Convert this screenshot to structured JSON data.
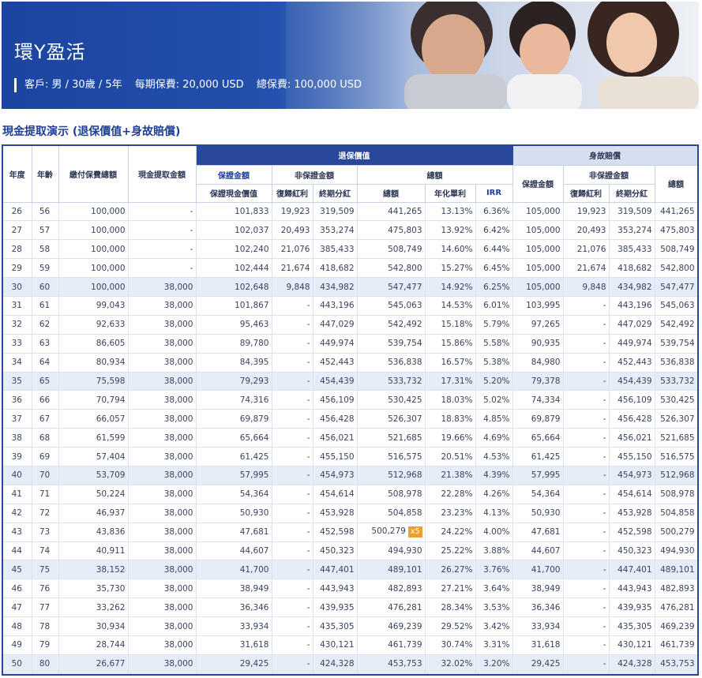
{
  "banner": {
    "title": "環Y盈活",
    "client": "客戶: 男 / 30歲 / 5年",
    "premium": "每期保費: 20,000 USD",
    "total_premium": "總保費: 100,000 USD"
  },
  "section_title": "現金提取演示 (退保價值+身故賠償)",
  "headers": {
    "year": "年度",
    "age": "年齡",
    "premium_paid": "繳付保費總額",
    "withdrawal": "現金提取金額",
    "surrender_group": "退保價值",
    "death_group": "身故賠償",
    "guaranteed": "保證金額",
    "non_guaranteed": "非保證金額",
    "total": "總額",
    "guaranteed_cash_value": "保證現金價值",
    "reversionary_bonus": "復歸紅利",
    "terminal_dividend": "終期分紅",
    "total_amount": "總額",
    "annual_simple": "年化單利",
    "irr": "IRR",
    "death_guaranteed": "保證金額",
    "death_non_guaranteed": "非保證金額",
    "death_total": "總額",
    "death_reversionary": "復歸紅利",
    "death_terminal": "終期分紅"
  },
  "rows": [
    {
      "y": "26",
      "a": "56",
      "p": "100,000",
      "w": "-",
      "g": "101,833",
      "rb": "19,923",
      "td": "319,509",
      "t": "441,265",
      "s": "13.13%",
      "irr": "6.36%",
      "dg": "105,000",
      "drb": "19,923",
      "dtd": "319,509",
      "dt": "441,265"
    },
    {
      "y": "27",
      "a": "57",
      "p": "100,000",
      "w": "-",
      "g": "102,037",
      "rb": "20,493",
      "td": "353,274",
      "t": "475,803",
      "s": "13.92%",
      "irr": "6.42%",
      "dg": "105,000",
      "drb": "20,493",
      "dtd": "353,274",
      "dt": "475,803"
    },
    {
      "y": "28",
      "a": "58",
      "p": "100,000",
      "w": "-",
      "g": "102,240",
      "rb": "21,076",
      "td": "385,433",
      "t": "508,749",
      "s": "14.60%",
      "irr": "6.44%",
      "dg": "105,000",
      "drb": "21,076",
      "dtd": "385,433",
      "dt": "508,749"
    },
    {
      "y": "29",
      "a": "59",
      "p": "100,000",
      "w": "-",
      "g": "102,444",
      "rb": "21,674",
      "td": "418,682",
      "t": "542,800",
      "s": "15.27%",
      "irr": "6.45%",
      "dg": "105,000",
      "drb": "21,674",
      "dtd": "418,682",
      "dt": "542,800"
    },
    {
      "y": "30",
      "a": "60",
      "p": "100,000",
      "w": "38,000",
      "g": "102,648",
      "rb": "9,848",
      "td": "434,982",
      "t": "547,477",
      "s": "14.92%",
      "irr": "6.25%",
      "dg": "105,000",
      "drb": "9,848",
      "dtd": "434,982",
      "dt": "547,477"
    },
    {
      "y": "31",
      "a": "61",
      "p": "99,043",
      "w": "38,000",
      "g": "101,867",
      "rb": "-",
      "td": "443,196",
      "t": "545,063",
      "s": "14.53%",
      "irr": "6.01%",
      "dg": "103,995",
      "drb": "-",
      "dtd": "443,196",
      "dt": "545,063"
    },
    {
      "y": "32",
      "a": "62",
      "p": "92,633",
      "w": "38,000",
      "g": "95,463",
      "rb": "-",
      "td": "447,029",
      "t": "542,492",
      "s": "15.18%",
      "irr": "5.79%",
      "dg": "97,265",
      "drb": "-",
      "dtd": "447,029",
      "dt": "542,492"
    },
    {
      "y": "33",
      "a": "63",
      "p": "86,605",
      "w": "38,000",
      "g": "89,780",
      "rb": "-",
      "td": "449,974",
      "t": "539,754",
      "s": "15.86%",
      "irr": "5.58%",
      "dg": "90,935",
      "drb": "-",
      "dtd": "449,974",
      "dt": "539,754"
    },
    {
      "y": "34",
      "a": "64",
      "p": "80,934",
      "w": "38,000",
      "g": "84,395",
      "rb": "-",
      "td": "452,443",
      "t": "536,838",
      "s": "16.57%",
      "irr": "5.38%",
      "dg": "84,980",
      "drb": "-",
      "dtd": "452,443",
      "dt": "536,838"
    },
    {
      "y": "35",
      "a": "65",
      "p": "75,598",
      "w": "38,000",
      "g": "79,293",
      "rb": "-",
      "td": "454,439",
      "t": "533,732",
      "s": "17.31%",
      "irr": "5.20%",
      "dg": "79,378",
      "drb": "-",
      "dtd": "454,439",
      "dt": "533,732"
    },
    {
      "y": "36",
      "a": "66",
      "p": "70,794",
      "w": "38,000",
      "g": "74,316",
      "rb": "-",
      "td": "456,109",
      "t": "530,425",
      "s": "18.03%",
      "irr": "5.02%",
      "dg": "74,334",
      "drb": "-",
      "dtd": "456,109",
      "dt": "530,425"
    },
    {
      "y": "37",
      "a": "67",
      "p": "66,057",
      "w": "38,000",
      "g": "69,879",
      "rb": "-",
      "td": "456,428",
      "t": "526,307",
      "s": "18.83%",
      "irr": "4.85%",
      "dg": "69,879",
      "drb": "-",
      "dtd": "456,428",
      "dt": "526,307"
    },
    {
      "y": "38",
      "a": "68",
      "p": "61,599",
      "w": "38,000",
      "g": "65,664",
      "rb": "-",
      "td": "456,021",
      "t": "521,685",
      "s": "19.66%",
      "irr": "4.69%",
      "dg": "65,664",
      "drb": "-",
      "dtd": "456,021",
      "dt": "521,685"
    },
    {
      "y": "39",
      "a": "69",
      "p": "57,404",
      "w": "38,000",
      "g": "61,425",
      "rb": "-",
      "td": "455,150",
      "t": "516,575",
      "s": "20.51%",
      "irr": "4.53%",
      "dg": "61,425",
      "drb": "-",
      "dtd": "455,150",
      "dt": "516,575"
    },
    {
      "y": "40",
      "a": "70",
      "p": "53,709",
      "w": "38,000",
      "g": "57,995",
      "rb": "-",
      "td": "454,973",
      "t": "512,968",
      "s": "21.38%",
      "irr": "4.39%",
      "dg": "57,995",
      "drb": "-",
      "dtd": "454,973",
      "dt": "512,968"
    },
    {
      "y": "41",
      "a": "71",
      "p": "50,224",
      "w": "38,000",
      "g": "54,364",
      "rb": "-",
      "td": "454,614",
      "t": "508,978",
      "s": "22.28%",
      "irr": "4.26%",
      "dg": "54,364",
      "drb": "-",
      "dtd": "454,614",
      "dt": "508,978"
    },
    {
      "y": "42",
      "a": "72",
      "p": "46,937",
      "w": "38,000",
      "g": "50,930",
      "rb": "-",
      "td": "453,928",
      "t": "504,858",
      "s": "23.23%",
      "irr": "4.13%",
      "dg": "50,930",
      "drb": "-",
      "dtd": "453,928",
      "dt": "504,858"
    },
    {
      "y": "43",
      "a": "73",
      "p": "43,836",
      "w": "38,000",
      "g": "47,681",
      "rb": "-",
      "td": "452,598",
      "t": "500,279",
      "badge": "x5",
      "s": "24.22%",
      "irr": "4.00%",
      "dg": "47,681",
      "drb": "-",
      "dtd": "452,598",
      "dt": "500,279"
    },
    {
      "y": "44",
      "a": "74",
      "p": "40,911",
      "w": "38,000",
      "g": "44,607",
      "rb": "-",
      "td": "450,323",
      "t": "494,930",
      "s": "25.22%",
      "irr": "3.88%",
      "dg": "44,607",
      "drb": "-",
      "dtd": "450,323",
      "dt": "494,930"
    },
    {
      "y": "45",
      "a": "75",
      "p": "38,152",
      "w": "38,000",
      "g": "41,700",
      "rb": "-",
      "td": "447,401",
      "t": "489,101",
      "s": "26.27%",
      "irr": "3.76%",
      "dg": "41,700",
      "drb": "-",
      "dtd": "447,401",
      "dt": "489,101"
    },
    {
      "y": "46",
      "a": "76",
      "p": "35,730",
      "w": "38,000",
      "g": "38,949",
      "rb": "-",
      "td": "443,943",
      "t": "482,893",
      "s": "27.21%",
      "irr": "3.64%",
      "dg": "38,949",
      "drb": "-",
      "dtd": "443,943",
      "dt": "482,893"
    },
    {
      "y": "47",
      "a": "77",
      "p": "33,262",
      "w": "38,000",
      "g": "36,346",
      "rb": "-",
      "td": "439,935",
      "t": "476,281",
      "s": "28.34%",
      "irr": "3.53%",
      "dg": "36,346",
      "drb": "-",
      "dtd": "439,935",
      "dt": "476,281"
    },
    {
      "y": "48",
      "a": "78",
      "p": "30,934",
      "w": "38,000",
      "g": "33,934",
      "rb": "-",
      "td": "435,305",
      "t": "469,239",
      "s": "29.52%",
      "irr": "3.42%",
      "dg": "33,934",
      "drb": "-",
      "dtd": "435,305",
      "dt": "469,239"
    },
    {
      "y": "49",
      "a": "79",
      "p": "28,744",
      "w": "38,000",
      "g": "31,618",
      "rb": "-",
      "td": "430,121",
      "t": "461,739",
      "s": "30.74%",
      "irr": "3.31%",
      "dg": "31,618",
      "drb": "-",
      "dtd": "430,121",
      "dt": "461,739"
    },
    {
      "y": "50",
      "a": "80",
      "p": "26,677",
      "w": "38,000",
      "g": "29,425",
      "rb": "-",
      "td": "424,328",
      "t": "453,753",
      "s": "32.02%",
      "irr": "3.20%",
      "dg": "29,425",
      "drb": "-",
      "dtd": "424,328",
      "dt": "453,753"
    }
  ],
  "highlight_years": [
    "30",
    "35",
    "40",
    "45",
    "50"
  ],
  "colors": {
    "brand_blue": "#27489b",
    "header_light": "#d6dff0",
    "row_highlight": "#e6ecf8",
    "badge": "#e9a030"
  }
}
